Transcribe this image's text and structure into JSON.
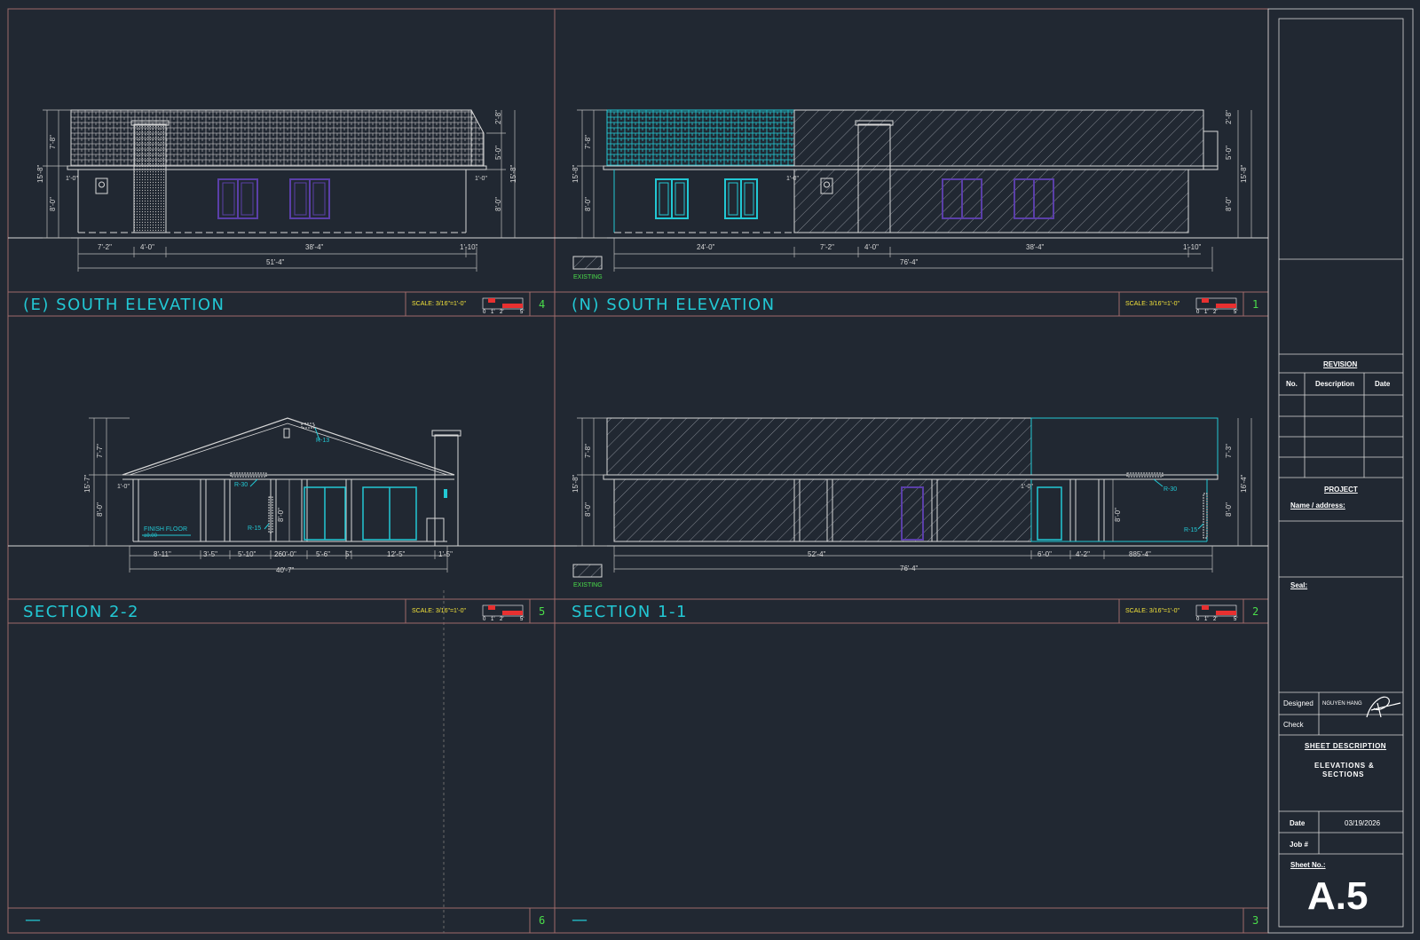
{
  "views": {
    "e_south": {
      "title": "(E) SOUTH ELEVATION",
      "number": "4"
    },
    "n_south": {
      "title": "(N) SOUTH ELEVATION",
      "number": "1"
    },
    "section22": {
      "title": "SECTION 2-2",
      "number": "5"
    },
    "section11": {
      "title": "SECTION 1-1",
      "number": "2"
    },
    "blank6": {
      "title": "—",
      "number": "6"
    },
    "blank3": {
      "title": "—",
      "number": "3"
    }
  },
  "scale_label": "SCALE:  3/16\"=1'-0\"",
  "scale_ticks": [
    "0",
    "1'",
    "2'",
    "5'"
  ],
  "legend": {
    "existing": "EXISTING"
  },
  "dims": {
    "e_south": {
      "bottom": [
        "7'-2\"",
        "4'-0\"",
        "38'-4\"",
        "1'-10\""
      ],
      "total": "51'-4\"",
      "left": [
        "7'-8\"",
        "8'-0\"",
        "15'-8\""
      ],
      "left_small": "1'-0\"",
      "right": [
        "2'-8\"",
        "5'-0\"",
        "8'-0\"",
        "15'-8\""
      ],
      "right_small": "1'-0\""
    },
    "n_south": {
      "bottom": [
        "24'-0\"",
        "7'-2\"",
        "4'-0\"",
        "38'-4\"",
        "1'-10\""
      ],
      "total": "76'-4\"",
      "left": [
        "7'-8\"",
        "8'-0\"",
        "15'-8\""
      ],
      "right": [
        "2'-8\"",
        "5'-0\"",
        "8'-0\"",
        "15'-8\""
      ],
      "small": "1'-0\""
    },
    "section22": {
      "bottom": [
        "8'-11\"",
        "3'-5\"",
        "5'-10\"",
        "260'-0\"",
        "5'-6\"",
        "5\"",
        "12'-5\"",
        "1'-5\""
      ],
      "total": "40'-7\"",
      "left": [
        "7'-7\"",
        "8'-0\"",
        "15'-7\""
      ],
      "left_small": "1'-0\"",
      "inner": "8'-0\"",
      "labels": [
        "R-13",
        "R-30",
        "R-15"
      ],
      "floor": [
        "FINISH FLOOR",
        "±0.00"
      ]
    },
    "section11": {
      "bottom": [
        "52'-4\"",
        "6'-0\"",
        "4'-2\"",
        "885'-4\""
      ],
      "total": "76'-4\"",
      "left": [
        "7'-8\"",
        "8'-0\"",
        "15'-8\""
      ],
      "right": [
        "7'-3\"",
        "8'-0\"",
        "16'-4\""
      ],
      "inner": "8'-0\"",
      "small": "1'-0\"",
      "labels": [
        "R-30",
        "R-15"
      ]
    }
  },
  "title_block": {
    "revision": {
      "heading": "REVISION",
      "columns": [
        "No.",
        "Description",
        "Date"
      ]
    },
    "project": {
      "heading": "PROJECT",
      "name_label": "Name / address:"
    },
    "seal_label": "Seal:",
    "designed_label": "Designed",
    "designed_value": "NGUYEN HANG",
    "check_label": "Check",
    "sheet_description": {
      "heading": "SHEET DESCRIPTION",
      "line1": "ELEVATIONS &",
      "line2": "SECTIONS"
    },
    "date_label": "Date",
    "date_value": "03/19/2026",
    "job_label": "Job #",
    "sheet_no_label": "Sheet No.:",
    "sheet_no": "A.5"
  },
  "colors": {
    "background": "#212832",
    "frame": "#a06a6a",
    "line": "#d8d8d8",
    "cyan": "#22c8d4",
    "window": "#5a3fa8",
    "green": "#4ade4a",
    "yellow": "#f2e23a",
    "red": "#e83030"
  }
}
